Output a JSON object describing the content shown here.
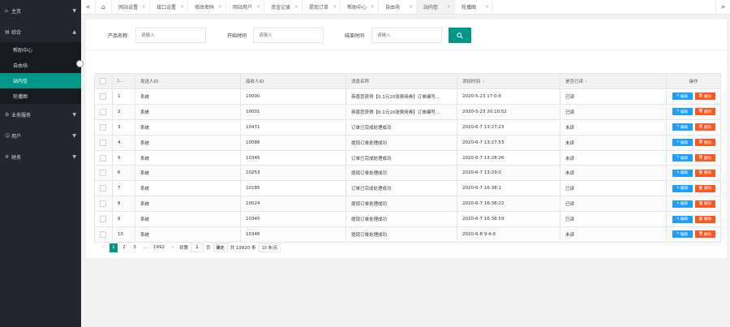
{
  "sidebar": {
    "groups": [
      {
        "label": "主页",
        "icon": "home-icon",
        "expanded": false
      },
      {
        "label": "综合",
        "icon": "grid-icon",
        "expanded": true,
        "items": [
          "帮助中心",
          "自由块",
          "站内信",
          "轮播图"
        ],
        "active_item": "站内信"
      },
      {
        "label": "业务服务",
        "icon": "gear-icon",
        "expanded": false
      },
      {
        "label": "用户",
        "icon": "user-icon",
        "expanded": false
      },
      {
        "label": "财务",
        "icon": "settings-icon",
        "expanded": false
      }
    ]
  },
  "tabs": {
    "items": [
      "网站设置",
      "接口设置",
      "修改密码",
      "网站用户",
      "资金记录",
      "提现订单",
      "帮助中心",
      "自由块",
      "站内信",
      "轮播图"
    ],
    "active": "站内信"
  },
  "search": {
    "product_label": "产品名称",
    "product_placeholder": "请输入",
    "start_label": "开始时间",
    "start_placeholder": "请输入",
    "end_label": "结束时间",
    "end_placeholder": "请输入"
  },
  "table": {
    "headers": {
      "id": "I...",
      "sender": "发送人ID",
      "receiver": "接收人ID",
      "title": "消息名称",
      "time": "添加时间",
      "status": "是否已读",
      "op": "操作"
    },
    "edit_label": "编辑",
    "delete_label": "删除",
    "rows": [
      {
        "id": "1",
        "sender": "系统",
        "receiver": "10000",
        "title": "恭喜您获得【0.1元10张费用券】订单编号...",
        "time": "2020-5-23 17:0:8",
        "status": "已读"
      },
      {
        "id": "2",
        "sender": "系统",
        "receiver": "10001",
        "title": "恭喜您获得【0.1元10张费用券】订单编号...",
        "time": "2020-5-23 20:10:52",
        "status": "已读"
      },
      {
        "id": "3",
        "sender": "系统",
        "receiver": "10471",
        "title": "订单已完成处理成功",
        "time": "2020-6-7 13:27:23",
        "status": "未读"
      },
      {
        "id": "4",
        "sender": "系统",
        "receiver": "10086",
        "title": "提现订单处理成功",
        "time": "2020-6-7 13:27:53",
        "status": "未读"
      },
      {
        "id": "5",
        "sender": "系统",
        "receiver": "10345",
        "title": "订单已完成处理成功",
        "time": "2020-6-7 13:28:26",
        "status": "未读"
      },
      {
        "id": "6",
        "sender": "系统",
        "receiver": "10253",
        "title": "提现订单处理成功",
        "time": "2020-6-7 13:29:0",
        "status": "未读"
      },
      {
        "id": "7",
        "sender": "系统",
        "receiver": "10185",
        "title": "订单已完成处理成功",
        "time": "2020-6-7 16:38:1",
        "status": "已读"
      },
      {
        "id": "8",
        "sender": "系统",
        "receiver": "10024",
        "title": "提现订单处理成功",
        "time": "2020-6-7 16:38:22",
        "status": "已读"
      },
      {
        "id": "9",
        "sender": "系统",
        "receiver": "10345",
        "title": "提现订单处理成功",
        "time": "2020-6-7 16:38:59",
        "status": "已读"
      },
      {
        "id": "10",
        "sender": "系统",
        "receiver": "10346",
        "title": "提现订单处理成功",
        "time": "2020-6-8 9:4:9",
        "status": "未读"
      }
    ]
  },
  "pager": {
    "pages": [
      "1",
      "2",
      "3",
      "...",
      "1992"
    ],
    "current": "1",
    "goto_label": "到第",
    "goto_value": "1",
    "page_unit": "页",
    "confirm_label": "确定",
    "total": "共 19920 条",
    "page_size": "10 条/页"
  },
  "colors": {
    "sidebar_bg": "#23262e",
    "accent": "#009688",
    "edit": "#1e9fff",
    "delete": "#ff5722"
  }
}
